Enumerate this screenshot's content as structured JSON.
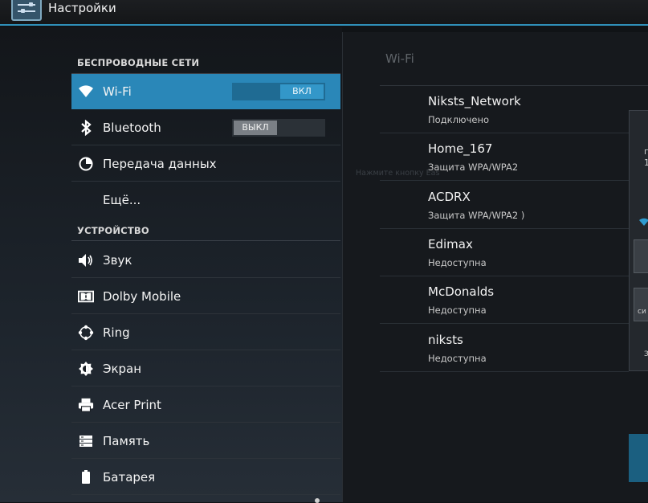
{
  "app": {
    "title": "Настройки"
  },
  "sidebar": {
    "sections": [
      {
        "label": "БЕСПРОВОДНЫЕ СЕТИ"
      },
      {
        "label": "УСТРОЙСТВО"
      }
    ],
    "items": [
      {
        "label": "Wi-Fi",
        "icon": "wifi-icon",
        "toggle": "ВКЛ",
        "toggle_state": "on",
        "selected": true
      },
      {
        "label": "Bluetooth",
        "icon": "bluetooth-icon",
        "toggle": "ВЫКЛ",
        "toggle_state": "off"
      },
      {
        "label": "Передача данных",
        "icon": "data-usage-icon"
      },
      {
        "label": "Ещё...",
        "icon": ""
      },
      {
        "label": "Звук",
        "icon": "speaker-icon"
      },
      {
        "label": "Dolby Mobile",
        "icon": "dolby-icon"
      },
      {
        "label": "Ring",
        "icon": "ring-icon"
      },
      {
        "label": "Экран",
        "icon": "brightness-icon"
      },
      {
        "label": "Acer Print",
        "icon": "printer-icon"
      },
      {
        "label": "Память",
        "icon": "storage-icon"
      },
      {
        "label": "Батарея",
        "icon": "battery-icon"
      }
    ]
  },
  "detail": {
    "title": "Wi-Fi",
    "ghost_text": "Нажмите кнопку Eas",
    "networks": [
      {
        "name": "Niksts_Network",
        "status": "Подключено"
      },
      {
        "name": "Home_167",
        "status": "Защита WPA/WPA2"
      },
      {
        "name": "ACDRX",
        "status": "Защита WPA/WPA2 )"
      },
      {
        "name": "Edimax",
        "status": "Недоступна"
      },
      {
        "name": "McDonalds",
        "status": "Недоступна"
      },
      {
        "name": "niksts",
        "status": "Недоступна"
      }
    ]
  },
  "dialog": {
    "fragments": [
      "п",
      "1",
      "си",
      "З"
    ]
  },
  "colors": {
    "accent": "#2a87b8",
    "toggle_on": "#3397c9",
    "actionbar_line": "#2f8fb8"
  }
}
